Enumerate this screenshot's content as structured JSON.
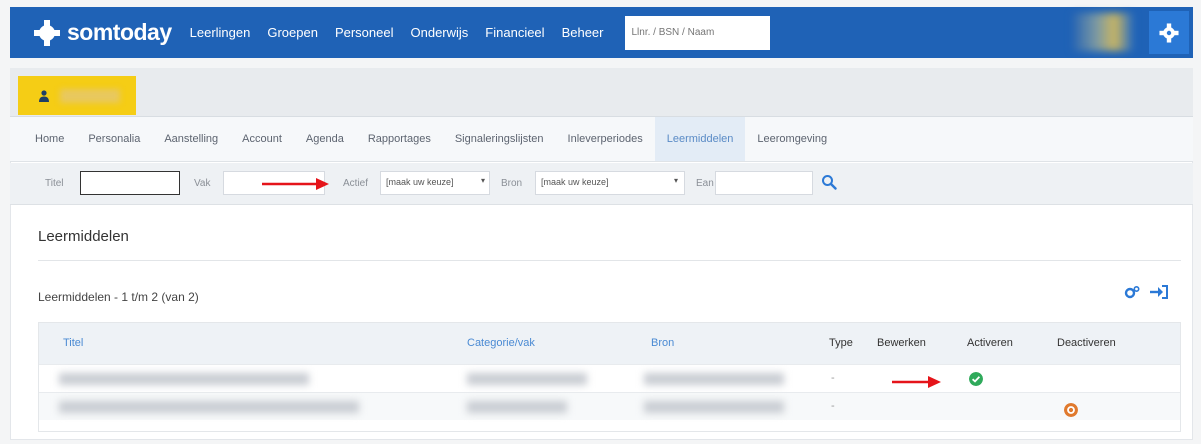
{
  "app": {
    "name": "somtoday"
  },
  "mainnav": [
    "Leerlingen",
    "Groepen",
    "Personeel",
    "Onderwijs",
    "Financieel",
    "Beheer"
  ],
  "search": {
    "placeholder": "Llnr. / BSN / Naam"
  },
  "subnav": {
    "items": [
      "Home",
      "Personalia",
      "Aanstelling",
      "Account",
      "Agenda",
      "Rapportages",
      "Signaleringslijsten",
      "Inleverperiodes",
      "Leermiddelen",
      "Leeromgeving"
    ],
    "active_index": 8
  },
  "filters": {
    "titel_label": "Titel",
    "vak_label": "Vak",
    "actief_label": "Actief",
    "actief_value": "[maak uw keuze]",
    "bron_label": "Bron",
    "bron_value": "[maak uw keuze]",
    "ean_label": "Ean",
    "search_icon": "search-icon"
  },
  "section": {
    "title": "Leermiddelen"
  },
  "list": {
    "title": "Leermiddelen - 1 t/m 2 (van 2)"
  },
  "table": {
    "columns": [
      "Titel",
      "Categorie/vak",
      "Bron",
      "Type",
      "Bewerken",
      "Activeren",
      "Deactiveren"
    ],
    "rows": [
      {
        "type": "-",
        "action": "activeren"
      },
      {
        "type": "-",
        "action": "deactiveren"
      }
    ]
  },
  "colors": {
    "brand": "#1f62b6",
    "accent_tab": "#f5cd15",
    "activate": "#2faa5b",
    "deactivate": "#e07a2e",
    "annotation_arrow": "#e5141a"
  }
}
